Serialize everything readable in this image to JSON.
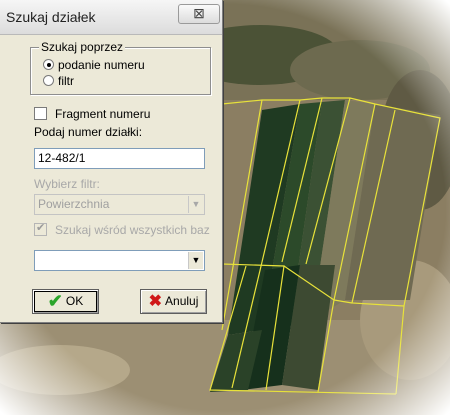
{
  "window": {
    "title": "Szukaj działek",
    "close_glyph": "⊠",
    "close_icon": "close-icon"
  },
  "search_by": {
    "legend": "Szukaj poprzez",
    "options": [
      {
        "label": "podanie numeru",
        "selected": true
      },
      {
        "label": "filtr",
        "selected": false
      }
    ]
  },
  "fragment": {
    "label": "Fragment numeru",
    "checked": false
  },
  "number_label": "Podaj numer działki:",
  "number_value": "12-482/1",
  "filter_label": "Wybierz filtr:",
  "filter_value": "Powierzchnia",
  "search_all": {
    "label": "Szukaj wśród wszystkich baz",
    "checked": true,
    "enabled": false
  },
  "extra_select_value": "",
  "buttons": {
    "ok": "OK",
    "cancel": "Anuluj",
    "ok_icon": "checkmark-icon",
    "cancel_icon": "x-icon"
  },
  "colors": {
    "parcel_outline": "#e8e23a",
    "dialog_bg": "#ece9d8"
  }
}
